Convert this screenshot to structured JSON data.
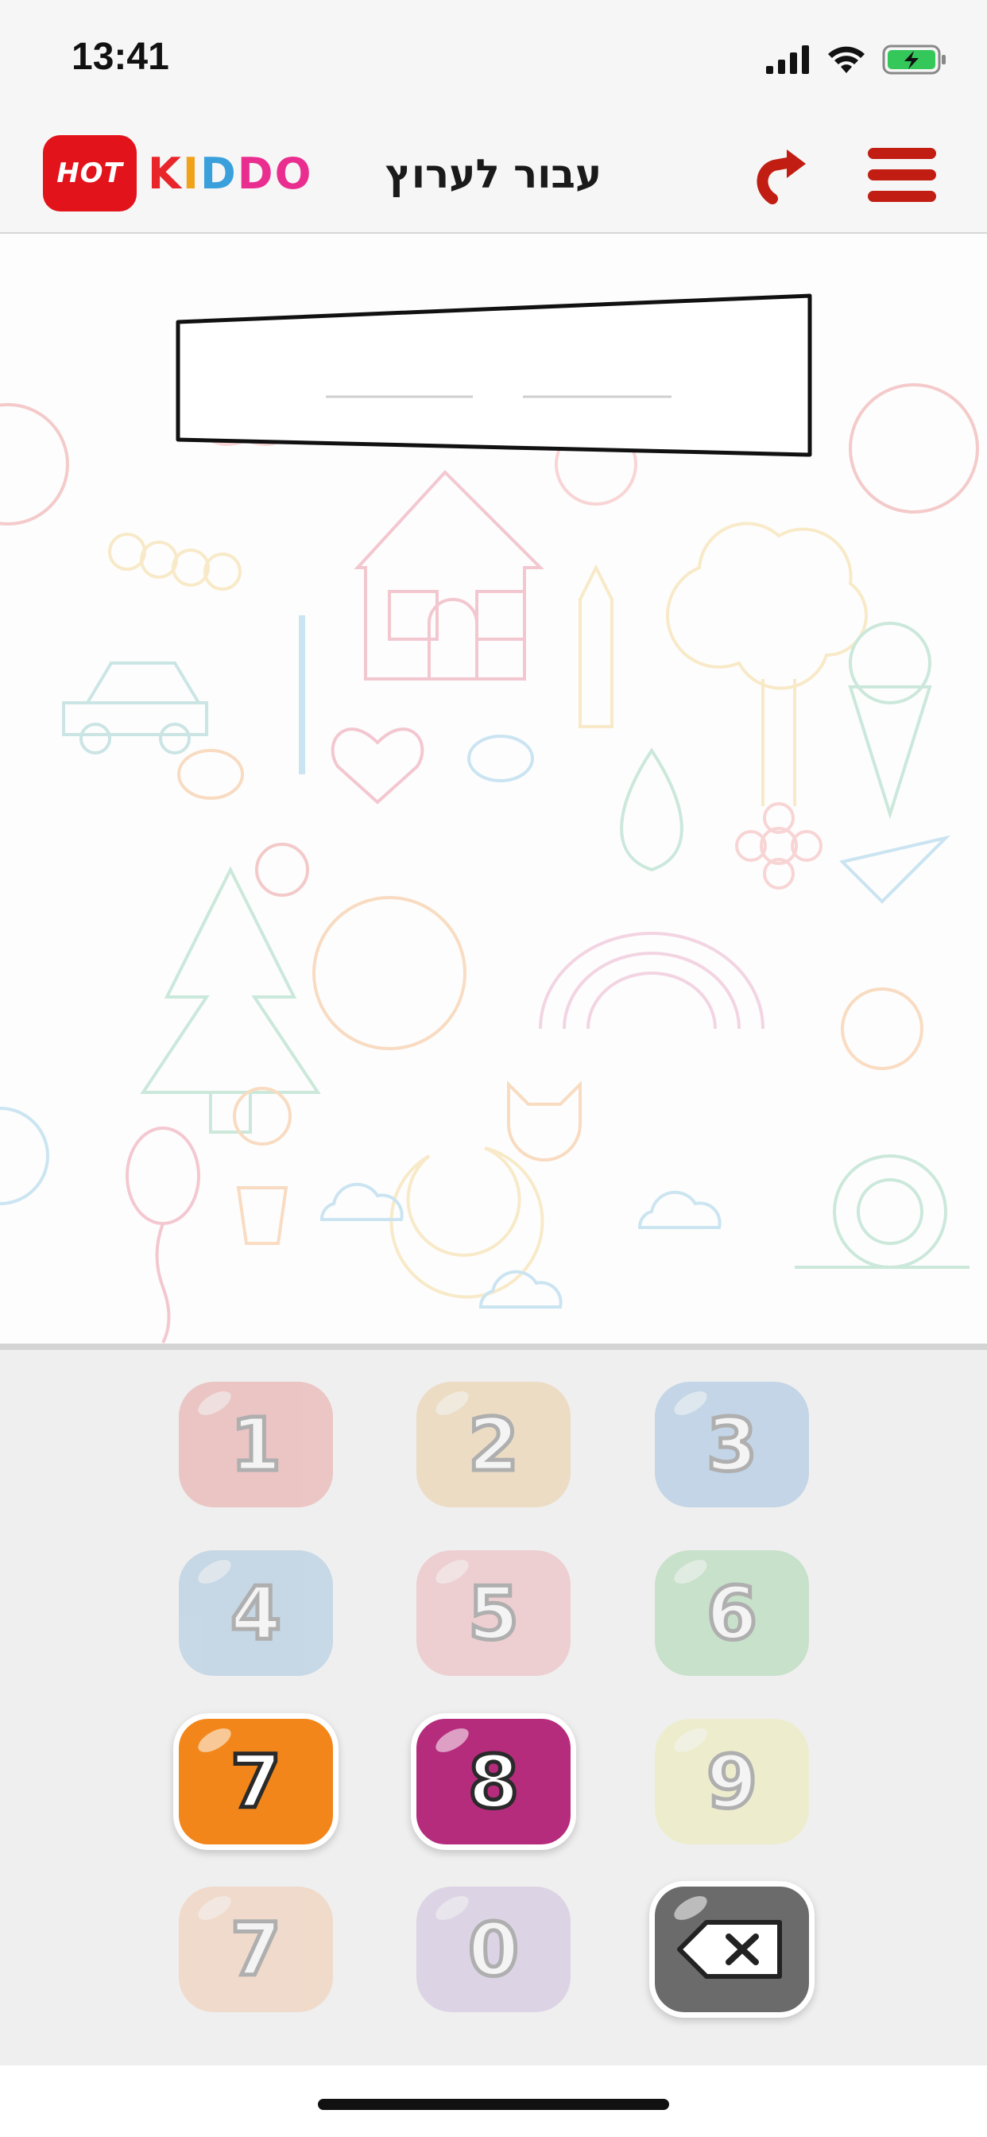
{
  "status_bar": {
    "time": "13:41"
  },
  "header": {
    "logo": {
      "badge_text": "HOT",
      "word_letters": [
        "K",
        "I",
        "D",
        "D",
        "O"
      ],
      "word_colors": [
        "#e8252a",
        "#f2a11b",
        "#3aa0dc",
        "#e92e8f",
        "#e92e8f"
      ]
    },
    "title": "עבור לערוץ",
    "redo_icon": "redo-arrow-icon",
    "menu_icon": "hamburger-menu-icon",
    "accent": "#c11d12"
  },
  "channel_input": {
    "digits": [
      "",
      ""
    ]
  },
  "keypad": {
    "keys": [
      {
        "label": "1",
        "color": "#e2706d",
        "state": "faded"
      },
      {
        "label": "2",
        "color": "#e8b769",
        "state": "faded"
      },
      {
        "label": "3",
        "color": "#6a9fd6",
        "state": "faded"
      },
      {
        "label": "4",
        "color": "#73a8d3",
        "state": "faded"
      },
      {
        "label": "5",
        "color": "#eb8a93",
        "state": "faded"
      },
      {
        "label": "6",
        "color": "#78c57f",
        "state": "faded"
      },
      {
        "label": "7",
        "color": "#f2861a",
        "state": "active"
      },
      {
        "label": "8",
        "color": "#b62c7d",
        "state": "active"
      },
      {
        "label": "9",
        "color": "#e9ea8c",
        "state": "faded"
      },
      {
        "label": "7",
        "color": "#f3b081",
        "state": "faded"
      },
      {
        "label": "0",
        "color": "#b59ed3",
        "state": "faded"
      }
    ],
    "backspace": {
      "icon": "backspace-icon",
      "color": "#6b6b6b",
      "state": "active"
    }
  }
}
